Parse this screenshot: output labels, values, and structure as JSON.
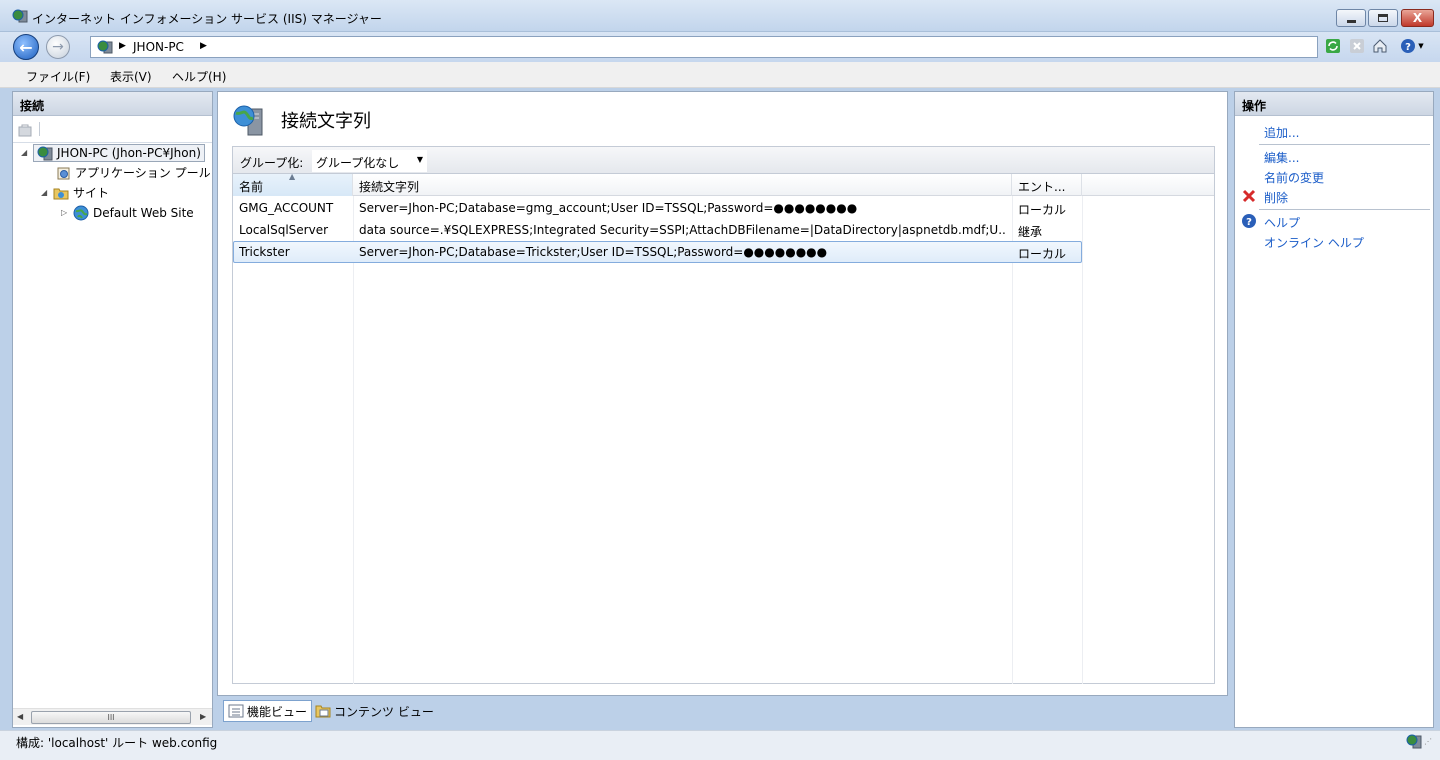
{
  "window": {
    "title": "インターネット インフォメーション サービス (IIS) マネージャー",
    "close_glyph": "X"
  },
  "address": {
    "node": "JHON-PC"
  },
  "menu": {
    "file": "ファイル(F)",
    "view": "表示(V)",
    "help": "ヘルプ(H)"
  },
  "connections": {
    "header": "接続",
    "tree": [
      {
        "label": "JHON-PC (Jhon-PC¥Jhon)",
        "icon": "server-icon"
      },
      {
        "label": "アプリケーション プール",
        "icon": "app-pool-icon"
      },
      {
        "label": "サイト",
        "icon": "sites-folder-icon"
      },
      {
        "label": "Default Web Site",
        "icon": "globe-icon"
      }
    ],
    "scroll_grip": "III"
  },
  "feature": {
    "title": "接続文字列",
    "group_label": "グループ化:",
    "group_value": "グループ化なし",
    "columns": {
      "name": "名前",
      "connection_string": "接続文字列",
      "entry_type": "エント..."
    },
    "rows": [
      {
        "name": "GMG_ACCOUNT",
        "connection_string": "Server=Jhon-PC;Database=gmg_account;User ID=TSSQL;Password=●●●●●●●●",
        "entry_type": "ローカル"
      },
      {
        "name": "LocalSqlServer",
        "connection_string": "data source=.¥SQLEXPRESS;Integrated Security=SSPI;AttachDBFilename=|DataDirectory|aspnetdb.mdf;U...",
        "entry_type": "継承"
      },
      {
        "name": "Trickster",
        "connection_string": "Server=Jhon-PC;Database=Trickster;User ID=TSSQL;Password=●●●●●●●●",
        "entry_type": "ローカル"
      }
    ],
    "selected_row": 2
  },
  "view_tabs": {
    "features": "機能ビュー",
    "content": "コンテンツ ビュー"
  },
  "actions": {
    "header": "操作",
    "add": "追加...",
    "edit": "編集...",
    "rename": "名前の変更",
    "delete": "削除",
    "help": "ヘルプ",
    "online_help": "オンライン ヘルプ"
  },
  "status": {
    "text": "構成: 'localhost' ルート web.config"
  },
  "colors": {
    "link": "#1a5cc8",
    "delete_icon": "#d62b2b",
    "help_icon": "#2a5fb8"
  }
}
